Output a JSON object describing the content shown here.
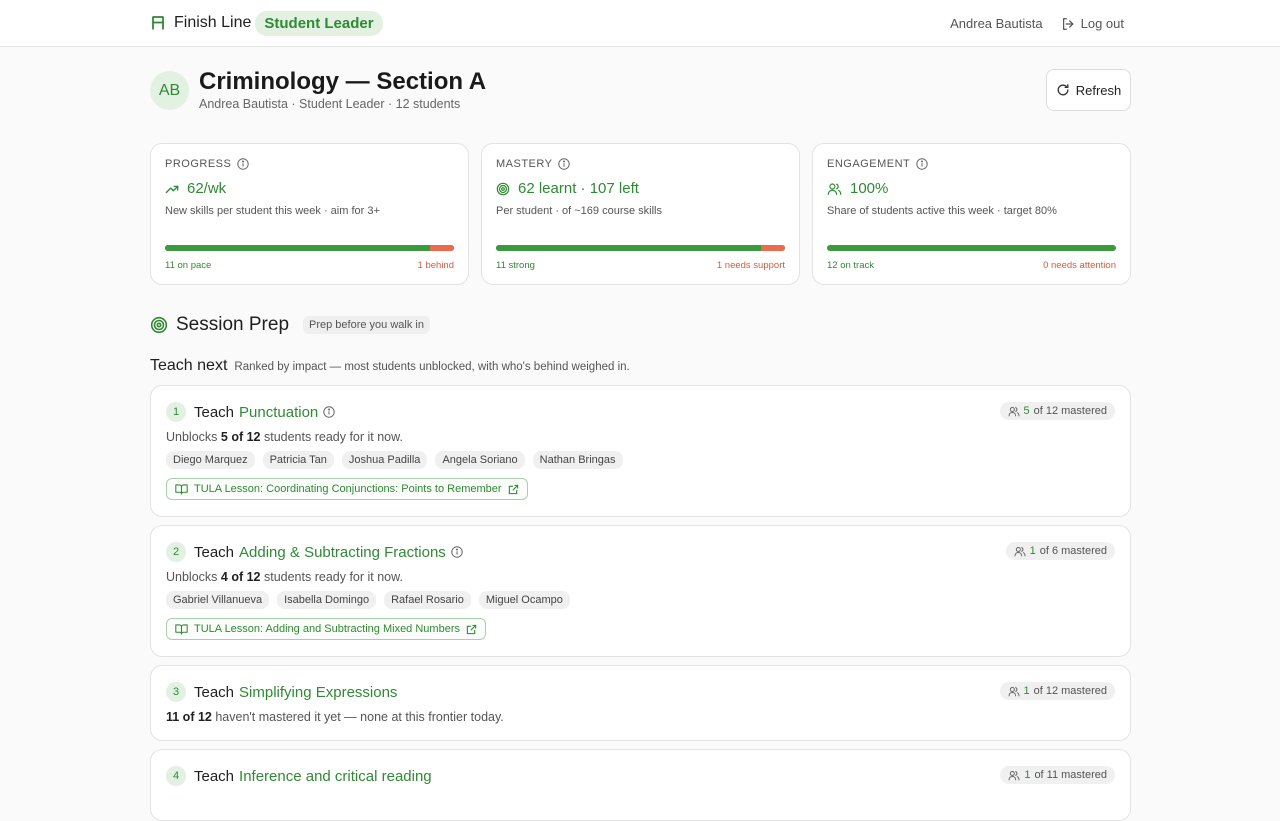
{
  "app": {
    "brand": "Finish Line",
    "role": "Student Leader",
    "user": "Andrea Bautista",
    "logout": "Log out",
    "accent": "#2f8a33",
    "alert": "#e96a4c"
  },
  "header": {
    "avatar": "AB",
    "title": "Criminology — Section A",
    "subtitle": "Andrea Bautista · Student Leader · 12 students",
    "refresh": "Refresh"
  },
  "metrics": [
    {
      "label": "PROGRESS",
      "icon": "trending-up-icon",
      "value": "62/wk",
      "desc": "New skills per student this week · aim for 3+",
      "good_count": 11,
      "bad_count": 1,
      "good_label": "11 on pace",
      "bad_label": "1 behind"
    },
    {
      "label": "MASTERY",
      "icon": "target-icon",
      "value": "62 learnt · 107 left",
      "desc": "Per student · of ~169 course skills",
      "good_count": 11,
      "bad_count": 1,
      "good_label": "11 strong",
      "bad_label": "1 needs support"
    },
    {
      "label": "ENGAGEMENT",
      "icon": "users-icon",
      "value": "100%",
      "desc": "Share of students active this week · target 80%",
      "good_count": 12,
      "bad_count": 0,
      "good_label": "12 on track",
      "bad_label": "0 needs attention"
    }
  ],
  "session": {
    "title": "Session Prep",
    "pill": "Prep before you walk in",
    "teach_next": "Teach next",
    "teach_sub": "Ranked by impact — most students unblocked, with who's behind weighed in."
  },
  "items": [
    {
      "rank": "1",
      "verb": "Teach",
      "skill": "Punctuation",
      "mastered_num": "5",
      "mastered_rest": "of 12 mastered",
      "line_pre": "Unblocks ",
      "line_bold": "5 of 12",
      "line_post": " students ready for it now.",
      "students": [
        "Diego Marquez",
        "Patricia Tan",
        "Joshua Padilla",
        "Angela Soriano",
        "Nathan Bringas"
      ],
      "lesson": "TULA Lesson: Coordinating Conjunctions: Points to Remember"
    },
    {
      "rank": "2",
      "verb": "Teach",
      "skill": "Adding & Subtracting Fractions",
      "mastered_num": "1",
      "mastered_rest": "of 6 mastered",
      "line_pre": "Unblocks ",
      "line_bold": "4 of 12",
      "line_post": " students ready for it now.",
      "students": [
        "Gabriel Villanueva",
        "Isabella Domingo",
        "Rafael Rosario",
        "Miguel Ocampo"
      ],
      "lesson": "TULA Lesson: Adding and Subtracting Mixed Numbers"
    },
    {
      "rank": "3",
      "verb": "Teach",
      "skill": "Simplifying Expressions",
      "mastered_num": "1",
      "mastered_rest": "of 12 mastered",
      "line_pre": "",
      "line_bold": "11 of 12",
      "line_post": " haven't mastered it yet — none at this frontier today."
    },
    {
      "rank": "4",
      "verb": "Teach",
      "skill": "Inference and critical reading",
      "mastered_num": "1",
      "mastered_rest": "of 11 mastered"
    }
  ]
}
